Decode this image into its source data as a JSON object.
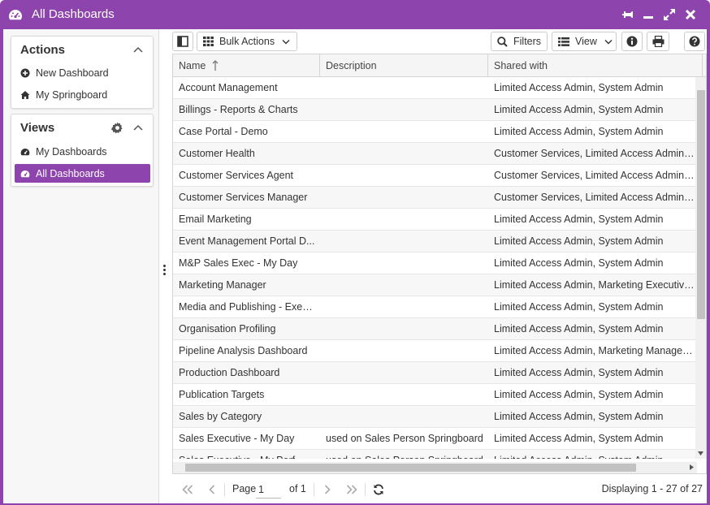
{
  "window": {
    "title": "All Dashboards",
    "title_icon": "dashboard-gauge-icon",
    "controls": [
      "pin-icon",
      "minimize-icon",
      "maximize-icon",
      "close-icon"
    ]
  },
  "actions_panel": {
    "heading": "Actions",
    "items": [
      {
        "label": "New Dashboard",
        "icon": "plus-circle-icon"
      },
      {
        "label": "My Springboard",
        "icon": "home-icon"
      }
    ]
  },
  "views_panel": {
    "heading": "Views",
    "items": [
      {
        "label": "My Dashboards",
        "icon": "dashboard-gauge-icon",
        "active": false
      },
      {
        "label": "All Dashboards",
        "icon": "dashboard-gauge-icon",
        "active": true
      }
    ]
  },
  "toolbar": {
    "bulk_actions": "Bulk Actions",
    "filters": "Filters",
    "view": "View"
  },
  "grid": {
    "columns": {
      "name": "Name",
      "description": "Description",
      "shared_with": "Shared with"
    },
    "rows": [
      {
        "name": "Account Management",
        "description": "",
        "shared_with": "Limited Access Admin, System Admin"
      },
      {
        "name": "Billings - Reports & Charts",
        "description": "",
        "shared_with": "Limited Access Admin, System Admin"
      },
      {
        "name": "Case Portal - Demo",
        "description": "",
        "shared_with": "Limited Access Admin, System Admin"
      },
      {
        "name": "Customer Health",
        "description": "",
        "shared_with": "Customer Services, Limited Access Admin, ..."
      },
      {
        "name": "Customer Services Agent",
        "description": "",
        "shared_with": "Customer Services, Limited Access Admin, ..."
      },
      {
        "name": "Customer Services Manager",
        "description": "",
        "shared_with": "Customer Services, Limited Access Admin, ..."
      },
      {
        "name": "Email Marketing",
        "description": "",
        "shared_with": "Limited Access Admin, System Admin"
      },
      {
        "name": "Event Management Portal D...",
        "description": "",
        "shared_with": "Limited Access Admin, System Admin"
      },
      {
        "name": "M&P Sales Exec - My Day",
        "description": "",
        "shared_with": "Limited Access Admin, System Admin"
      },
      {
        "name": "Marketing Manager",
        "description": "",
        "shared_with": "Limited Access Admin, Marketing Executive..."
      },
      {
        "name": "Media and Publishing - Exec...",
        "description": "",
        "shared_with": "Limited Access Admin, System Admin"
      },
      {
        "name": "Organisation Profiling",
        "description": "",
        "shared_with": "Limited Access Admin, System Admin"
      },
      {
        "name": "Pipeline Analysis Dashboard",
        "description": "",
        "shared_with": "Limited Access Admin, Marketing Manager,..."
      },
      {
        "name": "Production Dashboard",
        "description": "",
        "shared_with": "Limited Access Admin, System Admin"
      },
      {
        "name": "Publication Targets",
        "description": "",
        "shared_with": "Limited Access Admin, System Admin"
      },
      {
        "name": "Sales by Category",
        "description": "",
        "shared_with": "Limited Access Admin, System Admin"
      },
      {
        "name": "Sales Executive - My Day",
        "description": "used on Sales Person Springboard",
        "shared_with": "Limited Access Admin, System Admin"
      },
      {
        "name": "Sales Executive - My Perf...",
        "description": "used on Sales Person Springboard",
        "shared_with": "Limited Access Admin, System Admin"
      }
    ]
  },
  "pager": {
    "page_label": "Page",
    "page_value": "1",
    "of_label": "of 1",
    "displaying": "Displaying 1 - 27 of 27"
  },
  "colors": {
    "accent": "#8e44ad"
  }
}
